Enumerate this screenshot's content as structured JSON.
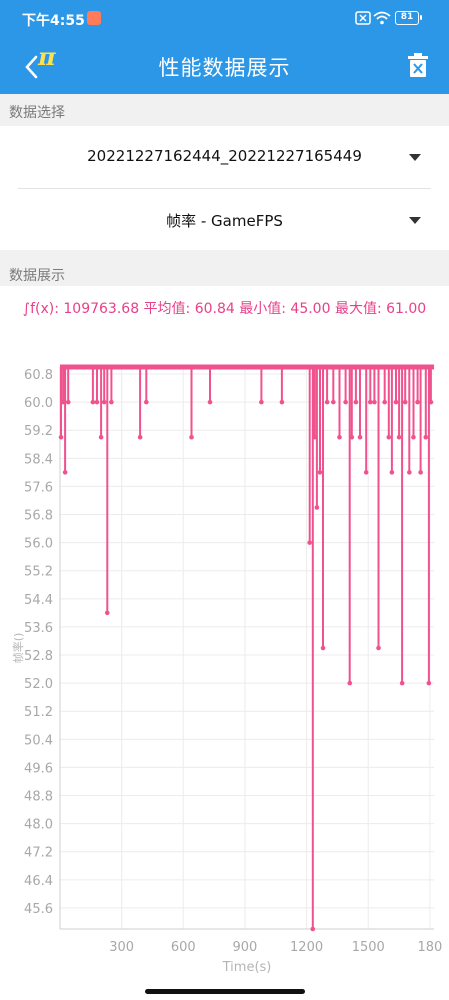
{
  "status": {
    "time": "下午4:55",
    "battery": "81",
    "icons": [
      "notification-icon",
      "no-sim-icon",
      "wifi-icon",
      "battery-icon"
    ]
  },
  "appbar": {
    "title": "性能数据展示",
    "logo_text": "π",
    "icons": [
      "back-arrow-icon",
      "app-logo-icon",
      "delete-icon"
    ]
  },
  "data_selection": {
    "header": "数据选择",
    "session": "20221227162444_20221227165449",
    "metric": "帧率 - GameFPS"
  },
  "data_display": {
    "header": "数据展示",
    "stats": "∫f(x): 109763.68 平均值: 60.84 最小值: 45.00 最大值: 61.00"
  },
  "colors": {
    "primary": "#2c97e6",
    "series": "#f0528e",
    "stats_text": "#e8408a"
  },
  "chart_data": {
    "type": "line",
    "xlabel": "Time(s)",
    "ylabel": "帧率()",
    "xlim": [
      0,
      1820
    ],
    "ylim": [
      45.0,
      61.0
    ],
    "x_ticks": [
      300,
      600,
      900,
      1200,
      1500,
      1800
    ],
    "x_tick_labels": [
      "300",
      "600",
      "900",
      "1200",
      "1500",
      "180"
    ],
    "y_ticks": [
      60.8,
      60.0,
      59.2,
      58.4,
      57.6,
      56.8,
      56.0,
      55.2,
      54.4,
      53.6,
      52.8,
      52.0,
      51.2,
      50.4,
      49.6,
      48.8,
      48.0,
      47.2,
      46.4,
      45.6
    ],
    "grid": true,
    "baseline": 61.0,
    "series": [
      {
        "dips": [
          [
            5,
            59.0
          ],
          [
            15,
            60.0
          ],
          [
            25,
            58.0
          ],
          [
            40,
            60.0
          ],
          [
            160,
            60.0
          ],
          [
            180,
            60.0
          ],
          [
            200,
            59.0
          ],
          [
            215,
            60.0
          ],
          [
            230,
            54.0
          ],
          [
            250,
            60.0
          ],
          [
            390,
            59.0
          ],
          [
            420,
            60.0
          ],
          [
            640,
            59.0
          ],
          [
            730,
            60.0
          ],
          [
            980,
            60.0
          ],
          [
            1080,
            60.0
          ],
          [
            1215,
            56.0
          ],
          [
            1230,
            45.0
          ],
          [
            1240,
            59.0
          ],
          [
            1250,
            57.0
          ],
          [
            1265,
            58.0
          ],
          [
            1280,
            53.0
          ],
          [
            1300,
            60.0
          ],
          [
            1330,
            60.0
          ],
          [
            1360,
            59.0
          ],
          [
            1390,
            60.0
          ],
          [
            1410,
            52.0
          ],
          [
            1420,
            59.0
          ],
          [
            1440,
            60.0
          ],
          [
            1460,
            59.0
          ],
          [
            1490,
            58.0
          ],
          [
            1510,
            60.0
          ],
          [
            1530,
            60.0
          ],
          [
            1550,
            53.0
          ],
          [
            1580,
            60.0
          ],
          [
            1600,
            59.0
          ],
          [
            1615,
            58.0
          ],
          [
            1635,
            60.0
          ],
          [
            1650,
            59.0
          ],
          [
            1665,
            52.0
          ],
          [
            1680,
            60.0
          ],
          [
            1700,
            58.0
          ],
          [
            1720,
            59.0
          ],
          [
            1740,
            60.0
          ],
          [
            1755,
            58.0
          ],
          [
            1780,
            59.0
          ],
          [
            1795,
            52.0
          ],
          [
            1805,
            60.0
          ]
        ]
      }
    ]
  }
}
